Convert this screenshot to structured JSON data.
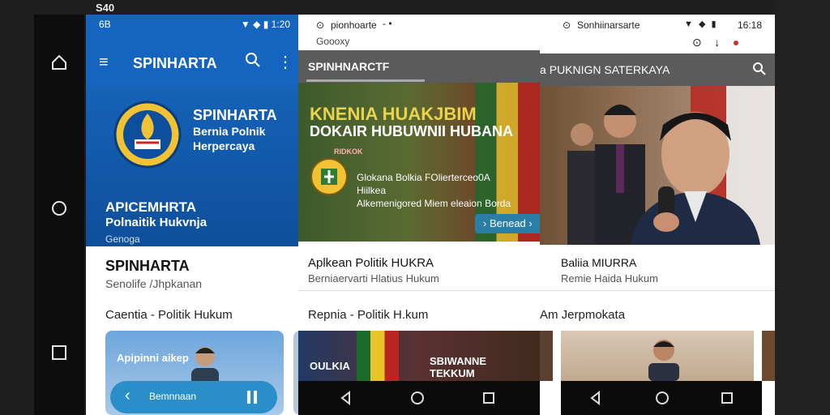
{
  "device": {
    "time": "S40"
  },
  "panel1": {
    "status_left": "6B",
    "status_right": "▼ ◆ ▮ 1:20",
    "app_title": "SPINHARTA",
    "hero": {
      "title": "SPINHARTA",
      "sub1": "Bernia Polnik",
      "sub2": "Herpercaya",
      "line1": "APICEMHRTA",
      "line2": "Polnaitik Hukvnja",
      "line3": "Genoga"
    },
    "card_title": "SPINHARTA",
    "card_sub": "Senolife /Jhpkanan",
    "section": "Caentia - Politik Hukum",
    "thumb_label": "Apipinni aikep",
    "player_label": "Bemnnaan"
  },
  "panel2": {
    "tab_text": "pionhoarte",
    "tab_close": "- •",
    "url_sub": "Goooxy",
    "tab_active": "SPINHNARCTF",
    "hero": {
      "headline1": "KNENIA HUAKJBIM",
      "headline2": "DOKAIR HUBUWNII HUBANA",
      "tag": "RIDKOK",
      "desc1": "Glokana Bolkia FOlierterceo0A",
      "desc2": "Hiilkea",
      "desc3": "Alkemenigored Miem eleaion Borda",
      "button": "Benead"
    },
    "card_title": "Aplkean Politik HUKRA",
    "card_sub": "Berniaervarti Hlatius Hukum",
    "section": "Repnia - Politik H.kum",
    "thumb_a": "OULKIA",
    "thumb_b": "SBIWANNE",
    "thumb_c": "TEKKUM"
  },
  "panel3": {
    "brand": "Sonhiinarsarte",
    "status_icons": "▼ ◆ ▮",
    "time": "16:18",
    "tab_text": "Bridkoan lAntia niia PUKNIGN SATERKAYA",
    "card_title": "Baliia MIURRA",
    "card_sub": "Remie Haida Hukum",
    "section": "Am Jerpmokata"
  }
}
